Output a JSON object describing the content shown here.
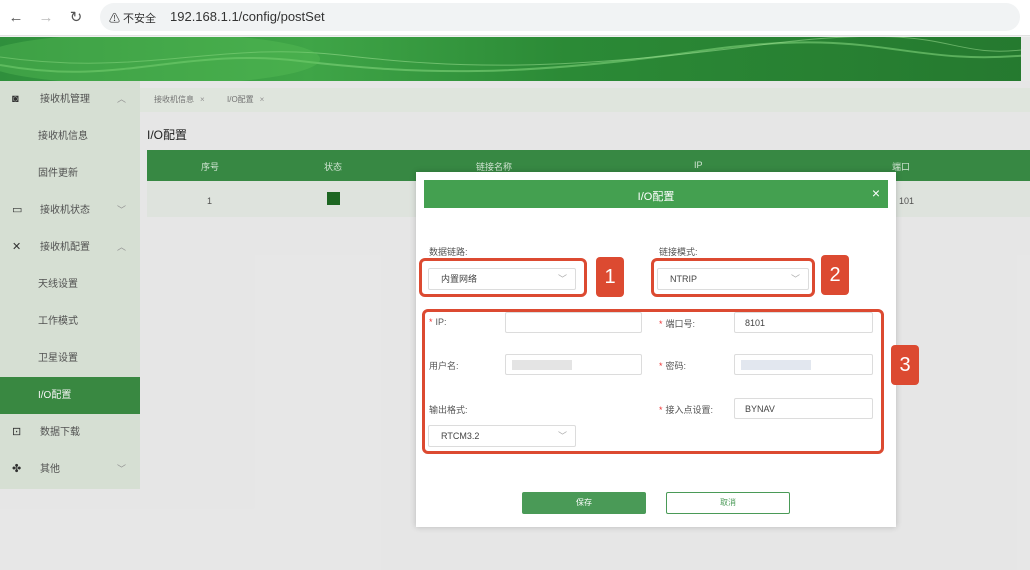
{
  "browser": {
    "back": "←",
    "forward": "→",
    "reload": "↻",
    "security": "⚠ 不安全",
    "url": "192.168.1.1/config/postSet"
  },
  "sidebar": {
    "items": [
      {
        "label": "接收机管理",
        "icon": "receiver-icon",
        "chevron": "︿"
      },
      {
        "label": "接收机信息"
      },
      {
        "label": "固件更新"
      },
      {
        "label": "接收机状态",
        "icon": "status-icon",
        "chevron": "﹀"
      },
      {
        "label": "接收机配置",
        "icon": "tools-icon",
        "chevron": "︿"
      },
      {
        "label": "天线设置"
      },
      {
        "label": "工作模式"
      },
      {
        "label": "卫星设置"
      },
      {
        "label": "I/O配置"
      },
      {
        "label": "数据下载",
        "icon": "download-icon"
      },
      {
        "label": "其他",
        "icon": "apps-icon",
        "chevron": "﹀"
      }
    ]
  },
  "tabs": [
    {
      "label": "接收机信息"
    },
    {
      "label": "I/O配置"
    }
  ],
  "page_title": "I/O配置",
  "table": {
    "headers": [
      "序号",
      "状态",
      "链接名称",
      "IP",
      "端口"
    ],
    "rows": [
      {
        "index": "1",
        "status_color": "#1f6b24",
        "port": "101"
      }
    ]
  },
  "dialog": {
    "title": "I/O配置",
    "close": "×",
    "data_link_label": "数据链路:",
    "data_link_value": "内置网络",
    "link_mode_label": "链接模式:",
    "link_mode_value": "NTRIP",
    "ip_label": "IP:",
    "ip_value": "",
    "port_label": "端口号:",
    "port_value": "8101",
    "username_label": "用户名:",
    "password_label": "密码:",
    "output_format_label": "输出格式:",
    "output_format_value": "RTCM3.2",
    "mountpoint_label": "接入点设置:",
    "mountpoint_value": "BYNAV",
    "required_mark": "*",
    "save": "保存",
    "cancel": "取消"
  },
  "annotations": [
    "1",
    "2",
    "3"
  ],
  "colors": {
    "primary_green": "#44a050",
    "sidebar_active": "#3c8e44",
    "highlight_red": "#dc4a31"
  }
}
